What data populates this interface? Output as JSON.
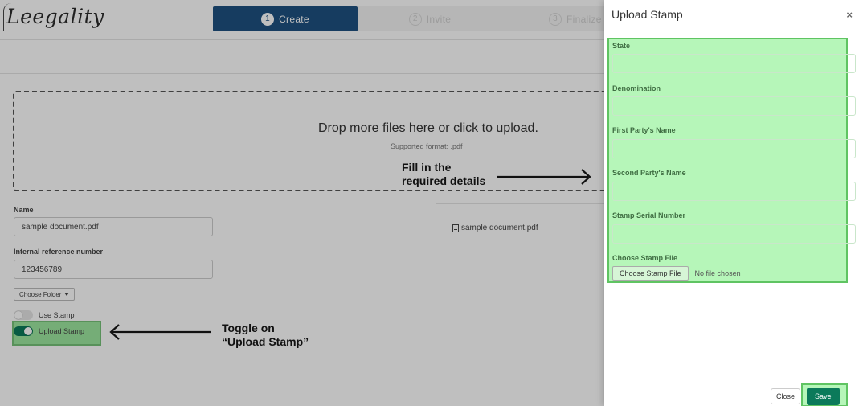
{
  "app": {
    "logo_text": "Leegality"
  },
  "steps": [
    {
      "num": "1",
      "label": "Create"
    },
    {
      "num": "2",
      "label": "Invite"
    },
    {
      "num": "3",
      "label": "Finalize"
    }
  ],
  "dropzone": {
    "title": "Drop more files here or click to upload.",
    "subtitle": "Supported format: .pdf"
  },
  "form": {
    "name_label": "Name",
    "name_value": "sample document.pdf",
    "ref_label": "Internal reference number",
    "ref_value": "123456789",
    "choose_folder": "Choose Folder",
    "use_stamp": "Use Stamp",
    "upload_stamp": "Upload Stamp",
    "use_stamp_on": false,
    "upload_stamp_on": true
  },
  "preview": {
    "file_name": "sample document.pdf"
  },
  "annotations": {
    "fill_line1": "Fill in the",
    "fill_line2": "required details",
    "toggle_line1": "Toggle on",
    "toggle_line2": "“Upload Stamp”"
  },
  "modal": {
    "title": "Upload Stamp",
    "close_symbol": "×",
    "fields": [
      {
        "label": "State",
        "value": ""
      },
      {
        "label": "Denomination",
        "value": ""
      },
      {
        "label": "First Party's Name",
        "value": ""
      },
      {
        "label": "Second Party's Name",
        "value": ""
      },
      {
        "label": "Stamp Serial Number",
        "value": ""
      }
    ],
    "file_label": "Choose Stamp File",
    "file_button": "Choose Stamp File",
    "file_status": "No file chosen",
    "close_button": "Close",
    "save_button": "Save"
  },
  "colors": {
    "primary": "#1e5180",
    "accent_green": "#0b7a5a",
    "highlight_green": "#b6f6b9"
  }
}
